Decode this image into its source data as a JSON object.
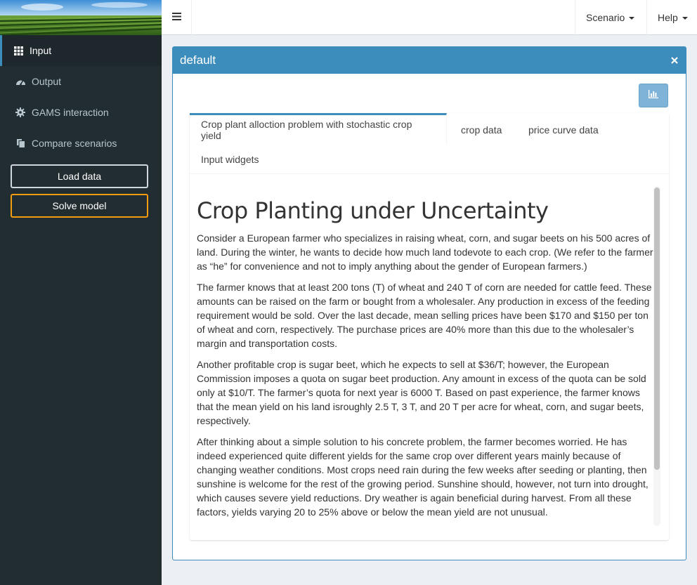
{
  "sidebar": {
    "items": [
      {
        "label": "Input",
        "icon": "grid-icon"
      },
      {
        "label": "Output",
        "icon": "dashboard-icon"
      },
      {
        "label": "GAMS interaction",
        "icon": "gear-icon"
      },
      {
        "label": "Compare scenarios",
        "icon": "copy-icon"
      }
    ],
    "load_label": "Load data",
    "solve_label": "Solve model"
  },
  "topbar": {
    "scenario_label": "Scenario",
    "help_label": "Help"
  },
  "box": {
    "title": "default",
    "tabs": [
      {
        "label": "Crop plant alloction problem with stochastic crop yield"
      },
      {
        "label": "crop data"
      },
      {
        "label": "price curve data"
      },
      {
        "label": "Input widgets"
      }
    ]
  },
  "article": {
    "heading": "Crop Planting under Uncertainty",
    "paragraphs": [
      "Consider a European farmer who specializes in raising wheat, corn, and sugar beets on his 500 acres of land. During the winter, he wants to decide how much land todevote to each crop. (We refer to the farmer as “he” for convenience and not to imply anything about the gender of European farmers.)",
      "The farmer knows that at least 200 tons (T) of wheat and 240 T of corn are needed for cattle feed. These amounts can be raised on the farm or bought from a wholesaler. Any production in excess of the feeding requirement would be sold. Over the last decade, mean selling prices have been $170 and $150 per ton of wheat and corn, respectively. The purchase prices are 40% more than this due to the wholesaler’s margin and transportation costs.",
      "Another profitable crop is sugar beet, which he expects to sell at $36/T; however, the European Commission imposes a quota on sugar beet production. Any amount in excess of the quota can be sold only at $10/T. The farmer’s quota for next year is 6000 T. Based on past experience, the farmer knows that the mean yield on his land isroughly 2.5 T, 3 T, and 20 T per acre for wheat, corn, and sugar beets, respectively.",
      "After thinking about a simple solution to his concrete problem, the farmer becomes worried. He has indeed experienced quite different yields for the same crop over different years mainly because of changing weather conditions. Most crops need rain during the few weeks after seeding or planting, then sunshine is welcome for the rest of the growing period. Sunshine should, however, not turn into drought, which causes severe yield reductions. Dry weather is again beneficial during harvest. From all these factors, yields varying 20 to 25% above or below the mean yield are not unusual."
    ]
  },
  "colors": {
    "sidebar_bg": "#222d32",
    "accent": "#3c8dbc",
    "warning": "#f39c12"
  }
}
